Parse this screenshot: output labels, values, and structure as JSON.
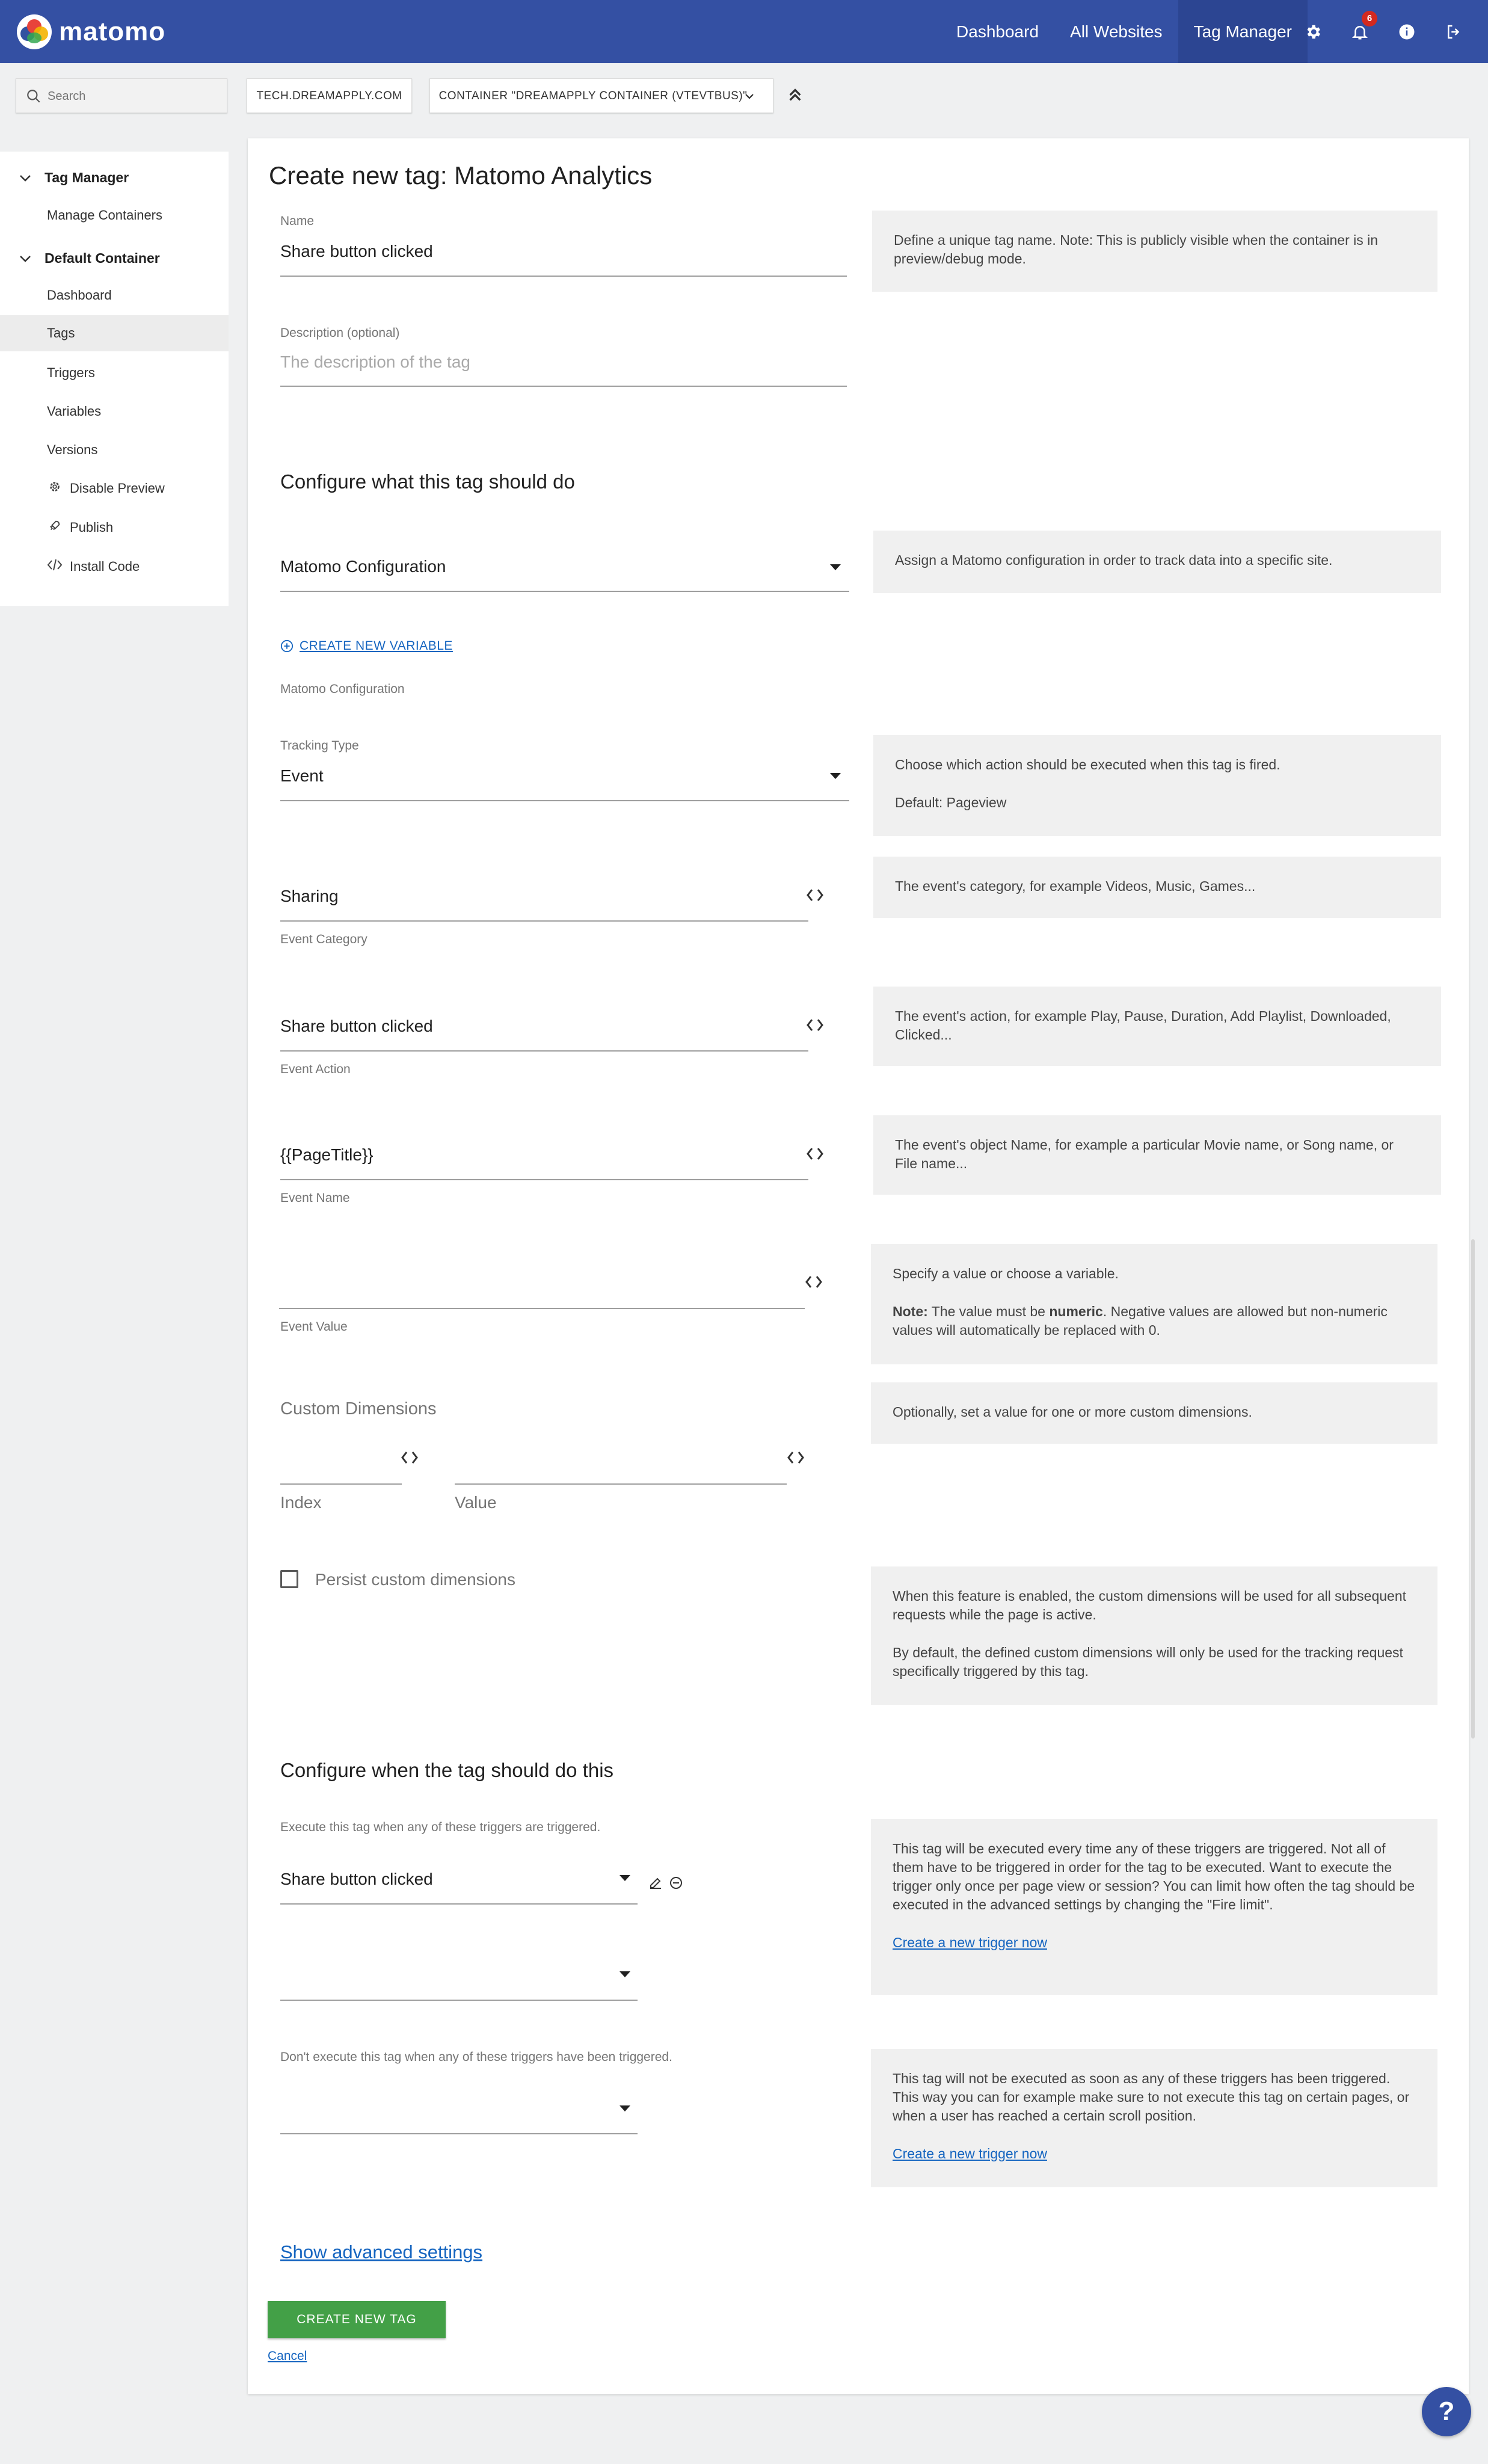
{
  "brand": {
    "name": "matomo"
  },
  "topnav": {
    "links": [
      "Dashboard",
      "All Websites",
      "Tag Manager"
    ],
    "notification_count": "6"
  },
  "toolbar": {
    "search_placeholder": "Search",
    "site": "TECH.DREAMAPPLY.COM",
    "container": "CONTAINER \"DREAMAPPLY CONTAINER (VTEVTBUS)\""
  },
  "sidebar": {
    "section1": "Tag Manager",
    "manage_containers": "Manage Containers",
    "section2": "Default Container",
    "items": [
      "Dashboard",
      "Tags",
      "Triggers",
      "Variables",
      "Versions",
      "Disable Preview",
      "Publish",
      "Install Code"
    ]
  },
  "form": {
    "title": "Create new tag: Matomo Analytics",
    "name_label": "Name",
    "name_value": "Share button clicked",
    "name_help": "Define a unique tag name. Note: This is publicly visible when the container is in preview/debug mode.",
    "description_label": "Description (optional)",
    "description_placeholder": "The description of the tag",
    "configure_title": "Configure what this tag should do",
    "matomo_config_value": "Matomo Configuration",
    "matomo_config_help": "Assign a Matomo configuration in order to track data into a specific site.",
    "create_variable": "CREATE NEW VARIABLE",
    "matomo_config_label": "Matomo Configuration",
    "tracking_type_label": "Tracking Type",
    "tracking_type_value": "Event",
    "tracking_type_help": "Choose which action should be executed when this tag is fired.",
    "tracking_type_default": "Default: Pageview",
    "event_category_value": "Sharing",
    "event_category_label": "Event Category",
    "event_category_help": "The event's category, for example Videos, Music, Games...",
    "event_action_value": "Share button clicked",
    "event_action_label": "Event Action",
    "event_action_help": "The event's action, for example Play, Pause, Duration, Add Playlist, Downloaded, Clicked...",
    "event_name_value": "{{PageTitle}}",
    "event_name_label": "Event Name",
    "event_name_help": "The event's object Name, for example a particular Movie name, or Song name, or File name...",
    "event_value_label": "Event Value",
    "event_value_help_1": "Specify a value or choose a variable.",
    "event_value_help_note": "Note:",
    "event_value_help_2": "The value must be",
    "event_value_help_numeric": "numeric",
    "event_value_help_3": ". Negative values are allowed but non-numeric values will automatically be replaced with 0.",
    "custom_dimensions_label": "Custom Dimensions",
    "custom_dimensions_help": "Optionally, set a value for one or more custom dimensions.",
    "index_label": "Index",
    "value_label": "Value",
    "persist_label": "Persist custom dimensions",
    "persist_help_1": "When this feature is enabled, the custom dimensions will be used for all subsequent requests while the page is active.",
    "persist_help_2": "By default, the defined custom dimensions will only be used for the tracking request specifically triggered by this tag.",
    "when_title": "Configure when the tag should do this",
    "fire_label": "Execute this tag when any of these triggers are triggered.",
    "fire_trigger_value": "Share button clicked",
    "fire_help": "This tag will be executed every time any of these triggers are triggered. Not all of them have to be triggered in order for the tag to be executed. Want to execute the trigger only once per page view or session? You can limit how often the tag should be executed in the advanced settings by changing the \"Fire limit\".",
    "create_trigger_link": "Create a new trigger now",
    "block_label": "Don't execute this tag when any of these triggers have been triggered.",
    "block_help": "This tag will not be executed as soon as any of these triggers has been triggered. This way you can for example make sure to not execute this tag on certain pages, or when a user has reached a certain scroll position.",
    "show_advanced": "Show advanced settings",
    "create_button": "CREATE NEW TAG",
    "cancel": "Cancel"
  },
  "help_fab": "?"
}
